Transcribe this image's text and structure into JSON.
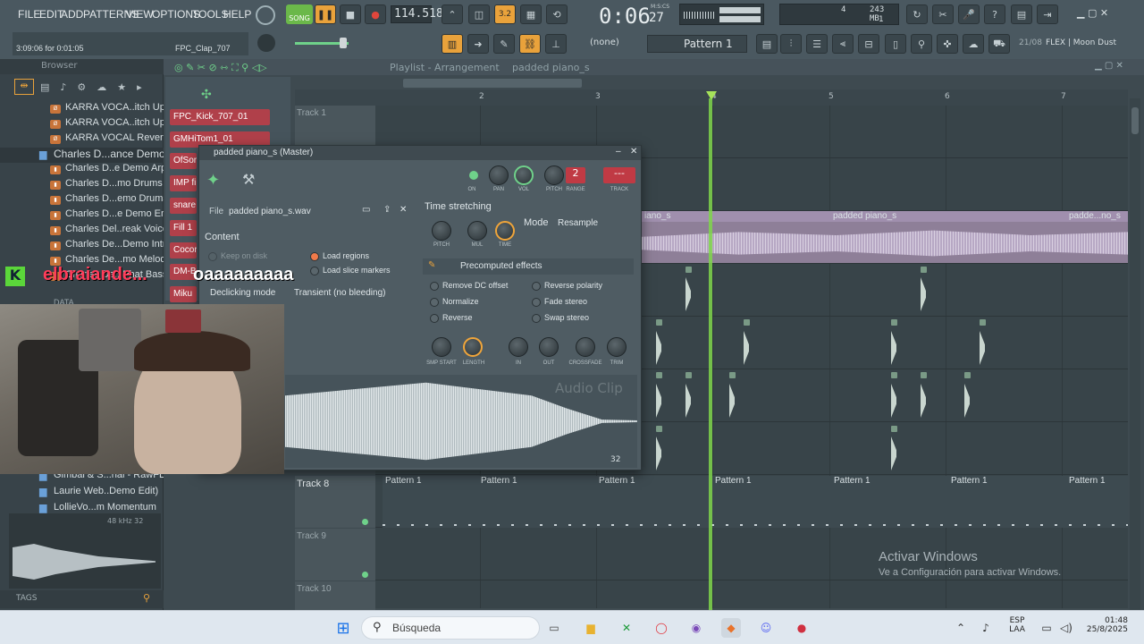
{
  "menu": [
    "FILE",
    "EDIT",
    "ADD",
    "PATTERNS",
    "VIEW",
    "OPTIONS",
    "TOOLS",
    "HELP"
  ],
  "transport": {
    "song_label": "SONG",
    "tempo": "114.518",
    "time": "0:06",
    "time_sub": "27",
    "time_mode": "M:S:CS",
    "cpu_val": "4",
    "mem": "243 MB",
    "voices": "1"
  },
  "hint": {
    "position": "3:09:06 for 0:01:05",
    "sample": "FPC_Clap_707"
  },
  "pattern": {
    "none": "(none)",
    "name": "Pattern 1"
  },
  "news": {
    "date": "21/08",
    "text": "FLEX | Moon Dust"
  },
  "browser": {
    "title": "Browser",
    "items": [
      {
        "label": "KARRA VOCA..itch Up 2",
        "icon": "audio-file-icon"
      },
      {
        "label": "KARRA VOCA..itch Up 3",
        "icon": "audio-file-icon"
      },
      {
        "label": "KARRA VOCAL Reversed",
        "icon": "audio-file-icon"
      },
      {
        "label": "Charles D...ance Demo",
        "icon": "folder-icon"
      },
      {
        "label": "Charles D..e Demo Arp",
        "icon": "audio-file-icon"
      },
      {
        "label": "Charles D...mo Drums 2",
        "icon": "audio-file-icon"
      },
      {
        "label": "Charles D...emo Drums",
        "icon": "audio-file-icon"
      },
      {
        "label": "Charles D...e Demo End",
        "icon": "audio-file-icon"
      },
      {
        "label": "Charles Del..reak Voice",
        "icon": "audio-file-icon"
      },
      {
        "label": "Charles De...Demo Intro",
        "icon": "audio-file-icon"
      },
      {
        "label": "Charles De...mo Melody",
        "icon": "audio-file-icon"
      },
      {
        "label": "Charles De...Phat Bass",
        "icon": "audio-file-icon"
      }
    ],
    "lower_items": [
      "Gimbal & S...rial - RawFL",
      "Laurie Web..Demo Edit)",
      "LollieVo...m Momentum"
    ],
    "preview_info": "48 kHz 32",
    "tags": "TAGS",
    "data_folder": "DATA"
  },
  "channels": [
    "FPC_Kick_707_01",
    "GMHiTom1_01",
    "OfSor",
    "IMP fi",
    "snare",
    "Fill 1",
    "Cocor",
    "DM-B",
    "Miku"
  ],
  "playlist": {
    "title": "Playlist - Arrangement",
    "pattern_name": "padded piano_s",
    "track1": "Track 1",
    "track8": "Track 8",
    "track9": "Track 9",
    "track10": "Track 10",
    "bar_numbers": [
      "2",
      "3",
      "4",
      "5",
      "6",
      "7"
    ],
    "audio_clip_labels": [
      "iano_s",
      "padded piano_s",
      "padde...no_s"
    ],
    "pattern_labels": [
      "Pattern 1",
      "Pattern 1",
      "Pattern 1",
      "Pattern 1",
      "Pattern 1",
      "Pattern 1",
      "Pattern 1"
    ]
  },
  "plugin": {
    "title": "padded piano_s (Master)",
    "file_label": "File",
    "file_name": "padded piano_s.wav",
    "content_label": "Content",
    "keep_on_disk": "Keep on disk",
    "load_regions": "Load regions",
    "load_slice_markers": "Load slice markers",
    "declicking_label": "Declicking mode",
    "declicking_value": "Transient (no bleeding)",
    "knob_labels": [
      "ON",
      "PAN",
      "VOL",
      "PITCH",
      "RANGE",
      "TRACK"
    ],
    "range_value": "2",
    "track_value": "---",
    "time_stretching": "Time stretching",
    "ts_knobs": [
      "PITCH",
      "MUL",
      "TIME"
    ],
    "mode_label": "Mode",
    "mode_value": "Resample",
    "precomputed": "Precomputed effects",
    "effects_left": [
      "Remove DC offset",
      "Normalize",
      "Reverse"
    ],
    "effects_right": [
      "Reverse polarity",
      "Fade stereo",
      "Swap stereo"
    ],
    "bottom_knobs": [
      "SMP START",
      "LENGTH",
      "IN",
      "OUT",
      "CROSSFADE",
      "TRIM"
    ],
    "watermark": "Audio Clip",
    "sample_bits": "32"
  },
  "overlay": {
    "name": "elbraiande...",
    "message": "oaaaaaaaaa"
  },
  "activation": {
    "title": "Activar Windows",
    "subtitle": "Ve a Configuración para activar Windows."
  },
  "taskbar": {
    "search": "Búsqueda",
    "lang1": "ESP",
    "lang2": "LAA",
    "time": "01:48",
    "date": "25/8/2025"
  }
}
